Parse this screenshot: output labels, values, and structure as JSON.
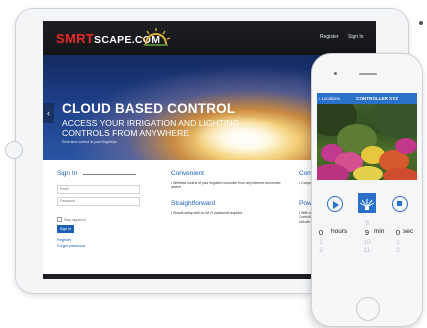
{
  "tablet": {
    "brand": {
      "smrt": "SMRT",
      "rest": "SCAPE.COM"
    },
    "nav": {
      "register": "Register",
      "signin": "Sign In"
    },
    "hero": {
      "title": "CLOUD BASED CONTROL",
      "subtitle": "ACCESS YOUR IRRIGATION AND LIGHTING CONTROLS FROM ANYWHERE",
      "small": "Real-time control at your fingertips"
    },
    "signin": {
      "title": "Sign In",
      "email_placeholder": "Email",
      "password_placeholder": "Password",
      "stay_label": "Stay signed in",
      "button": "Sign In",
      "register_link": "Register",
      "forgot_link": "Forgot password"
    },
    "features": [
      {
        "title": "Convenient",
        "text": "• Wireless control of your irrigation controller from any internet connected device."
      },
      {
        "title": "Straightforward",
        "text": "• Simple setup with no Wi-Fi password required"
      },
      {
        "title": "Compatible",
        "text": "• Compatible with ... controllers"
      },
      {
        "title": "Powerful",
        "text": "• With over 3 mi... \"Wi-fi\" Controll... take control wi... to include multi... lighting and mo..."
      }
    ]
  },
  "phone": {
    "back_label": "Locations",
    "title": "CONTROLLER XYZ",
    "timer": {
      "hours_above": "",
      "hours": "0",
      "hours_label": "hours",
      "minutes_above": "8",
      "minutes": "9",
      "minutes_label": "min",
      "seconds": "0",
      "seconds_label": "sec",
      "below1": [
        "1",
        "10",
        "1"
      ],
      "below2": [
        "2",
        "11",
        "2"
      ]
    }
  }
}
